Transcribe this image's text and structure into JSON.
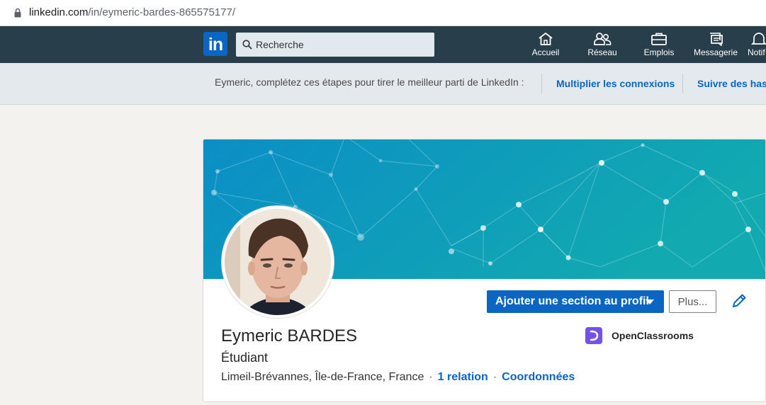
{
  "browser": {
    "url_host": "linkedin.com",
    "url_path": "/in/eymeric-bardes-865575177/"
  },
  "nav": {
    "logo_text": "in",
    "search_placeholder": "Recherche",
    "items": [
      {
        "label": "Accueil",
        "icon": "home-icon"
      },
      {
        "label": "Réseau",
        "icon": "network-icon"
      },
      {
        "label": "Emplois",
        "icon": "briefcase-icon"
      },
      {
        "label": "Messagerie",
        "icon": "messaging-icon"
      },
      {
        "label": "Notif",
        "icon": "bell-icon"
      }
    ]
  },
  "onboarding": {
    "text": "Eymeric, complétez ces étapes pour tirer le meilleur parti de LinkedIn :",
    "links": [
      "Multiplier les connexions",
      "Suivre des hash"
    ]
  },
  "profile": {
    "name": "Eymeric BARDES",
    "headline": "Étudiant",
    "location": "Limeil-Brévannes, Île-de-France, France",
    "connections": "1 relation",
    "contact": "Coordonnées",
    "add_section_label": "Ajouter une section au profil",
    "more_label": "Plus...",
    "organization": "OpenClassrooms"
  },
  "colors": {
    "nav_bg": "#283e4a",
    "brand_blue": "#0a66c2",
    "banner_start": "#0d93c4",
    "banner_end": "#10a8ad",
    "org_logo": "#7451eb"
  }
}
